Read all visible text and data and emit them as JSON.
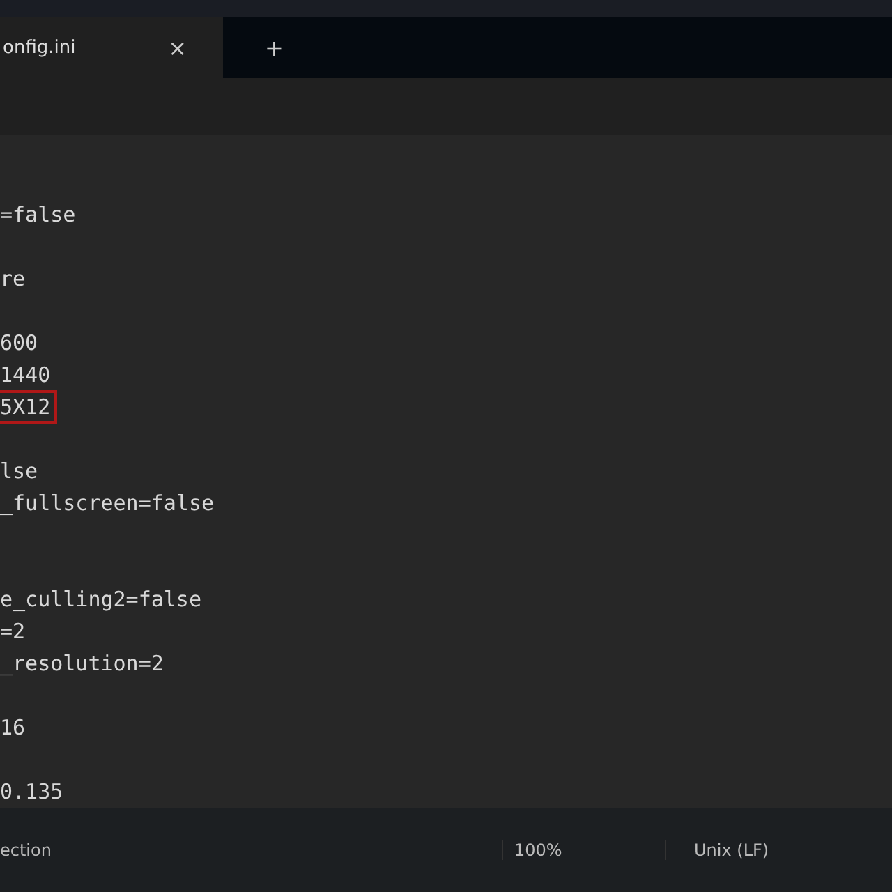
{
  "tabs": [
    {
      "label": "onfig.ini",
      "selected": true,
      "close": "×"
    }
  ],
  "new_tab": "+",
  "lines": [
    {
      "kind": "text",
      "text": "=false",
      "highlighted": false
    },
    {
      "kind": "blank"
    },
    {
      "kind": "text",
      "text": "re",
      "highlighted": false
    },
    {
      "kind": "blank"
    },
    {
      "kind": "text",
      "text": "600",
      "highlighted": false
    },
    {
      "kind": "text",
      "text": "1440",
      "highlighted": false
    },
    {
      "kind": "text",
      "text": "5X12",
      "highlighted": true
    },
    {
      "kind": "blank"
    },
    {
      "kind": "text",
      "text": "lse",
      "highlighted": false
    },
    {
      "kind": "text",
      "text": "_fullscreen=false",
      "highlighted": false
    },
    {
      "kind": "blank"
    },
    {
      "kind": "blank"
    },
    {
      "kind": "text",
      "text": "e_culling2=false",
      "highlighted": false
    },
    {
      "kind": "text",
      "text": "=2",
      "highlighted": false
    },
    {
      "kind": "text",
      "text": "_resolution=2",
      "highlighted": false
    },
    {
      "kind": "blank"
    },
    {
      "kind": "text",
      "text": "16",
      "highlighted": false
    },
    {
      "kind": "blank"
    },
    {
      "kind": "text",
      "text": "0.135",
      "highlighted": false
    }
  ],
  "status_bar": {
    "left": "ection",
    "zoom": "100%",
    "line_ending": "Unix (LF)"
  }
}
